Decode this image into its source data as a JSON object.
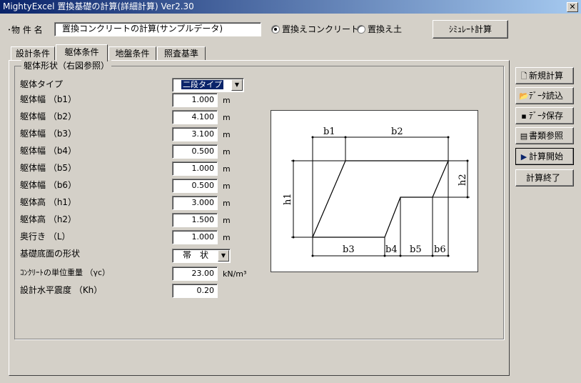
{
  "window": {
    "title": "MightyExcel 置換基礎の計算(詳細計算) Ver2.30",
    "close": "✕"
  },
  "header": {
    "property_label": "･物 件 名",
    "property_value": "置換コンクリートの計算(サンプルデータ)",
    "radio_concrete": "置換えコンクリート",
    "radio_soil": "置換え土",
    "radio_selected": "concrete",
    "simulate_button": "ｼﾐｭﾚｰﾄ計算"
  },
  "tabs": [
    {
      "label": "設計条件"
    },
    {
      "label": "躯体条件"
    },
    {
      "label": "地盤条件"
    },
    {
      "label": "照査基準"
    }
  ],
  "active_tab": 1,
  "group": {
    "legend": "躯体形状（右図参照）",
    "body_type_label": "躯体タイプ",
    "body_type_value": "二段タイプ",
    "fields": [
      {
        "label": "躯体幅 （b1）",
        "value": "1.000",
        "unit": "m"
      },
      {
        "label": "躯体幅 （b2）",
        "value": "4.100",
        "unit": "m"
      },
      {
        "label": "躯体幅 （b3）",
        "value": "3.100",
        "unit": "m"
      },
      {
        "label": "躯体幅 （b4）",
        "value": "0.500",
        "unit": "m"
      },
      {
        "label": "躯体幅 （b5）",
        "value": "1.000",
        "unit": "m"
      },
      {
        "label": "躯体幅 （b6）",
        "value": "0.500",
        "unit": "m"
      },
      {
        "label": "躯体高 （h1）",
        "value": "3.000",
        "unit": "m"
      },
      {
        "label": "躯体高 （h2）",
        "value": "1.500",
        "unit": "m"
      },
      {
        "label": "奥行き （L）",
        "value": "1.000",
        "unit": "m"
      }
    ],
    "base_shape_label": "基礎底面の形状",
    "base_shape_value": "帯　状",
    "unit_weight_label": "ｺﾝｸﾘｰﾄの単位重量 （γc）",
    "unit_weight_value": "23.00",
    "unit_weight_unit": "kN/m³",
    "kh_label": "設計水平震度 （Kh）",
    "kh_value": "0.20"
  },
  "diagram": {
    "labels": {
      "b1": "b1",
      "b2": "b2",
      "b3": "b3",
      "b4": "b4",
      "b5": "b5",
      "b6": "b6",
      "h1": "h1",
      "h2": "h2"
    }
  },
  "sidebar": {
    "new": {
      "icon": "new-document-icon",
      "label": "新規計算"
    },
    "load": {
      "icon": "open-folder-icon",
      "label": "ﾃﾞｰﾀ読込"
    },
    "save": {
      "icon": "floppy-disk-icon",
      "label": "ﾃﾞｰﾀ保存"
    },
    "docs": {
      "icon": "document-list-icon",
      "label": "書類参照"
    },
    "start": {
      "icon": "play-arrow-icon",
      "label": "計算開始"
    },
    "exit": {
      "label": "計算終了"
    }
  }
}
